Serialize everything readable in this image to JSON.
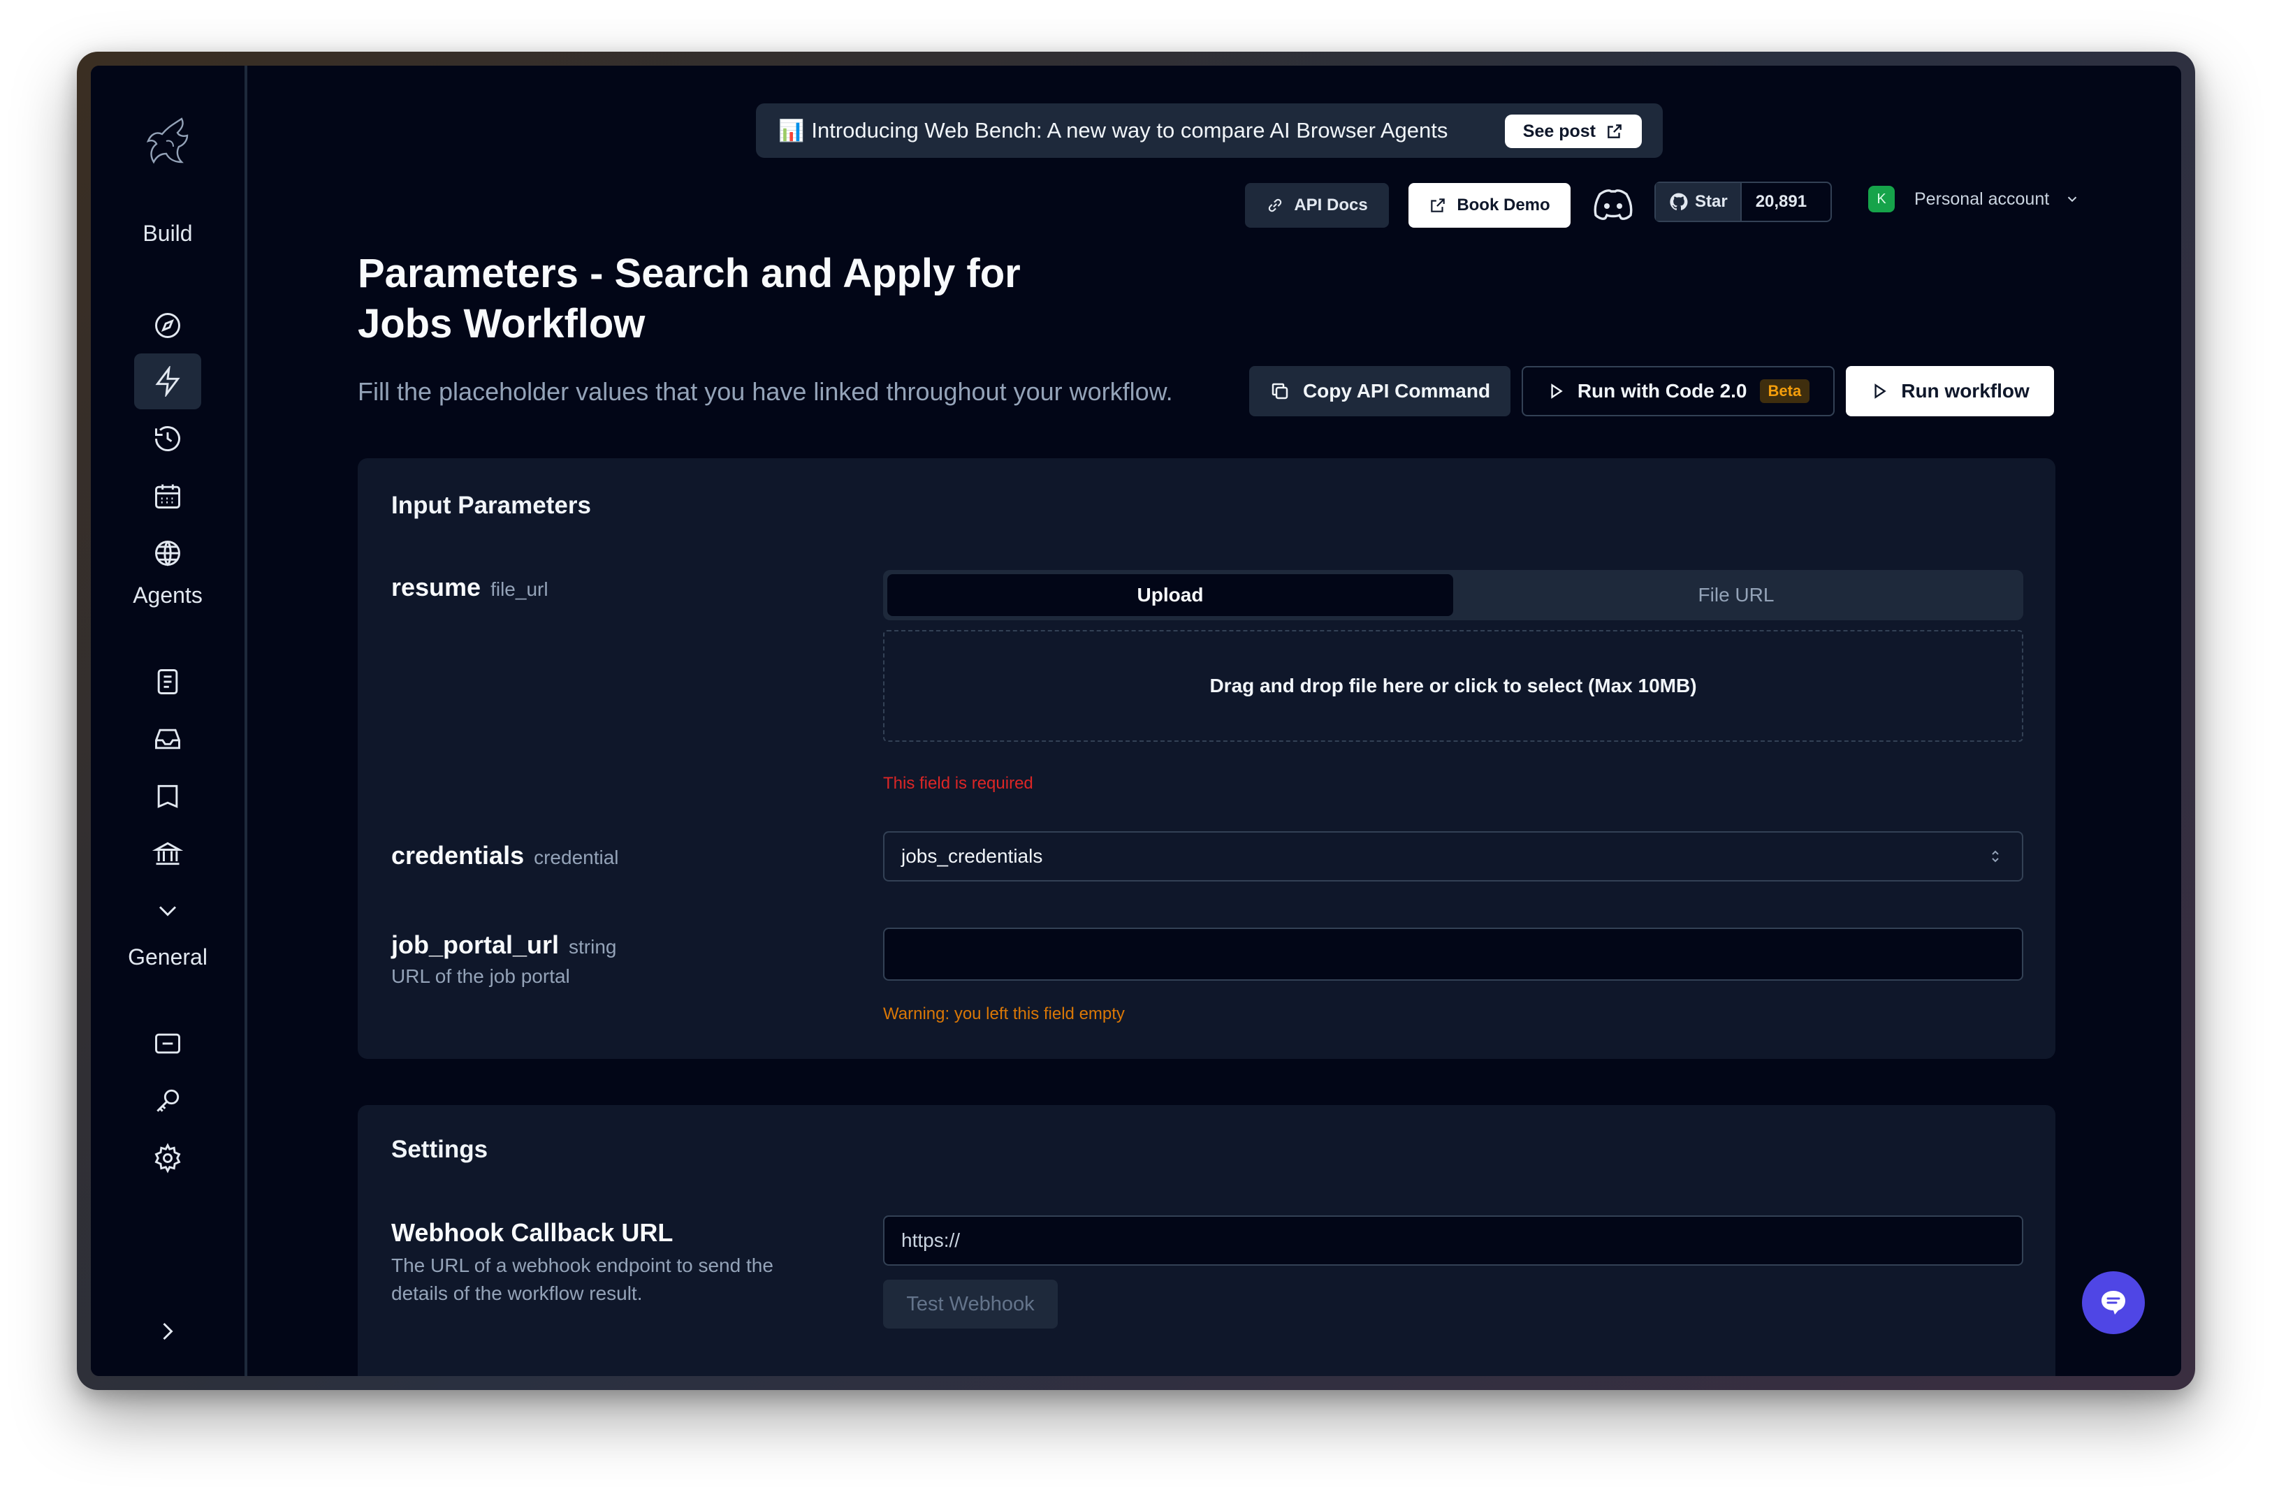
{
  "sidebar": {
    "sections": [
      {
        "label": "Build"
      },
      {
        "label": "Agents"
      },
      {
        "label": "General"
      }
    ],
    "build_items": [
      "compass-icon",
      "bolt-icon",
      "history-icon",
      "calendar-icon",
      "globe-icon"
    ],
    "agents_items": [
      "document-icon",
      "inbox-icon",
      "book-icon",
      "bank-icon",
      "chevron-down-icon"
    ],
    "general_items": [
      "card-icon",
      "key-icon",
      "gear-icon"
    ],
    "expand_icon": "chevron-right-icon"
  },
  "announcement": {
    "icon": "📊",
    "text": "Introducing Web Bench: A new way to compare AI Browser Agents",
    "button_label": "See post"
  },
  "header": {
    "api_docs_label": "API Docs",
    "book_demo_label": "Book Demo",
    "github_star_label": "Star",
    "github_star_count": "20,891",
    "avatar_letter": "K",
    "account_label": "Personal account"
  },
  "page": {
    "title": "Parameters - Search and Apply for Jobs Workflow",
    "subtitle": "Fill the placeholder values that you have linked throughout your workflow."
  },
  "actions": {
    "copy_api_label": "Copy API Command",
    "run_code_label": "Run with Code 2.0",
    "beta_badge": "Beta",
    "run_workflow_label": "Run workflow"
  },
  "input_parameters": {
    "title": "Input Parameters",
    "resume": {
      "name": "resume",
      "type": "file_url",
      "tabs": [
        "Upload",
        "File URL"
      ],
      "active_tab": "Upload",
      "dropzone_text": "Drag and drop file here or click to select (Max 10MB)",
      "error": "This field is required"
    },
    "credentials": {
      "name": "credentials",
      "type": "credential",
      "value": "jobs_credentials"
    },
    "job_portal_url": {
      "name": "job_portal_url",
      "type": "string",
      "description": "URL of the job portal",
      "value": "",
      "warning": "Warning: you left this field empty"
    }
  },
  "settings": {
    "title": "Settings",
    "webhook": {
      "name": "Webhook Callback URL",
      "description": "The URL of a webhook endpoint to send the details of the workflow result.",
      "placeholder": "https://",
      "test_button_label": "Test Webhook"
    }
  },
  "colors": {
    "background": "#020617",
    "card": "#0f172a",
    "accent_chat": "#4f46e5",
    "error": "#dc2626",
    "warning": "#d97706",
    "beta": "#f59e0b"
  }
}
